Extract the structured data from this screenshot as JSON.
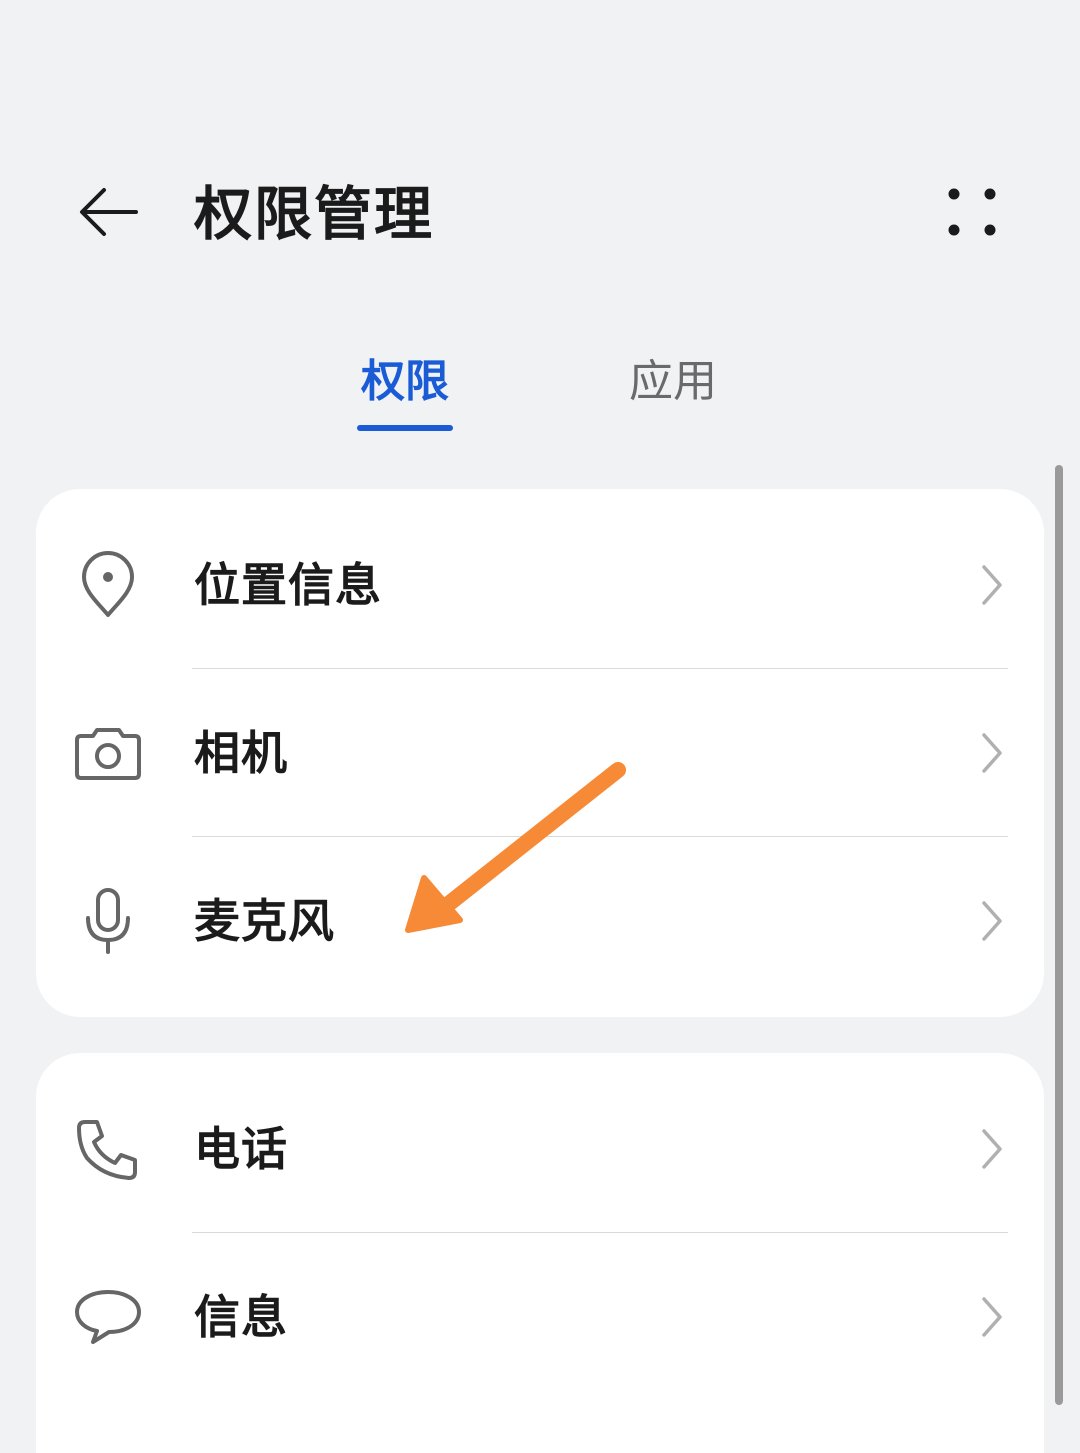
{
  "header": {
    "title": "权限管理"
  },
  "tabs": [
    {
      "label": "权限",
      "active": true
    },
    {
      "label": "应用",
      "active": false
    }
  ],
  "permissions_card": {
    "items": [
      {
        "label": "位置信息",
        "icon": "location-pin-icon"
      },
      {
        "label": "相机",
        "icon": "camera-icon"
      },
      {
        "label": "麦克风",
        "icon": "microphone-icon"
      }
    ]
  },
  "communication_card": {
    "items": [
      {
        "label": "电话",
        "icon": "phone-icon"
      },
      {
        "label": "信息",
        "icon": "message-bubble-icon"
      }
    ]
  },
  "colors": {
    "accent": "#1a5bd6",
    "annotation_arrow": "#f78a36",
    "background": "#f1f2f4",
    "card": "#ffffff"
  }
}
